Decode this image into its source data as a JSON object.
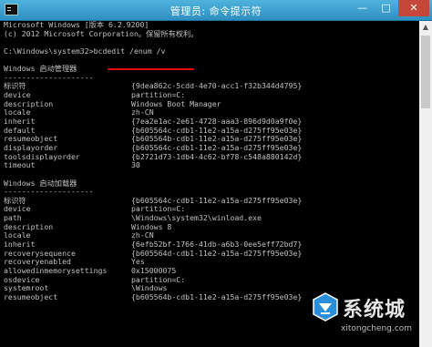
{
  "window": {
    "title": "管理员: 命令提示符",
    "buttons": {
      "minimize": "—",
      "maximize": "□",
      "close": "✕"
    },
    "accent": "#3a9dcc"
  },
  "console_lines": [
    "Microsoft Windows [版本 6.2.9200]",
    "(c) 2012 Microsoft Corporation。保留所有权利。",
    "",
    "C:\\Windows\\system32>bcdedit /enum /v",
    "",
    "Windows 启动管理器",
    "--------------------",
    [
      "标识符",
      "{9dea862c-5cdd-4e70-acc1-f32b344d4795}"
    ],
    [
      "device",
      "partition=C:"
    ],
    [
      "description",
      "Windows Boot Manager"
    ],
    [
      "locale",
      "zh-CN"
    ],
    [
      "inherit",
      "{7ea2e1ac-2e61-4728-aaa3-896d9d0a9f0e}"
    ],
    [
      "default",
      "{b605564c-cdb1-11e2-a15a-d275ff95e03e}"
    ],
    [
      "resumeobject",
      "{b605564b-cdb1-11e2-a15a-d275ff95e03e}"
    ],
    [
      "displayorder",
      "{b605564c-cdb1-11e2-a15a-d275ff95e03e}"
    ],
    [
      "toolsdisplayorder",
      "{b2721d73-1db4-4c62-bf78-c548a880142d}"
    ],
    [
      "timeout",
      "30"
    ],
    "",
    "Windows 启动加载器",
    "--------------------",
    [
      "标识符",
      "{b605564c-cdb1-11e2-a15a-d275ff95e03e}"
    ],
    [
      "device",
      "partition=C:"
    ],
    [
      "path",
      "\\Windows\\system32\\winload.exe"
    ],
    [
      "description",
      "Windows 8"
    ],
    [
      "locale",
      "zh-CN"
    ],
    [
      "inherit",
      "{6efb52bf-1766-41db-a6b3-0ee5eff72bd7}"
    ],
    [
      "recoverysequence",
      "{b605564d-cdb1-11e2-a15a-d275ff95e03e}"
    ],
    [
      "recoveryenabled",
      "Yes"
    ],
    [
      "allowedinmemorysettings",
      "0x15000075"
    ],
    [
      "osdevice",
      "partition=C:"
    ],
    [
      "systemroot",
      "\\Windows"
    ],
    [
      "resumeobject",
      "{b605564b-cdb1-11e2-a15a-d275ff95e03e}"
    ]
  ],
  "watermark": {
    "name": "系统城",
    "url": "xitongcheng.com"
  },
  "scrollbar": {
    "up_arrow": "▲"
  }
}
